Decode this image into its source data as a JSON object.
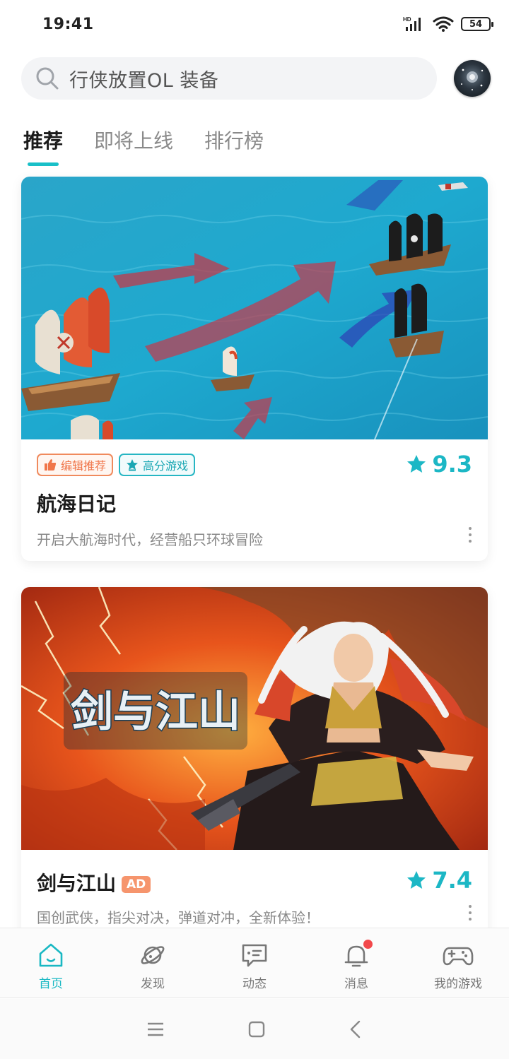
{
  "status_bar": {
    "time": "19:41",
    "battery": "54",
    "network": "HD"
  },
  "search": {
    "placeholder": "行侠放置OL 装备"
  },
  "tabs": [
    {
      "label": "推荐",
      "active": true
    },
    {
      "label": "即将上线",
      "active": false
    },
    {
      "label": "排行榜",
      "active": false
    }
  ],
  "cards": [
    {
      "badges": [
        "编辑推荐",
        "高分游戏"
      ],
      "title": "航海日记",
      "rating": "9.3",
      "description": "开启大航海时代，经营船只环球冒险"
    },
    {
      "title": "剑与江山",
      "ad_label": "AD",
      "rating": "7.4",
      "description": "国创武侠，指尖对决，弹道对冲，全新体验！",
      "banner_logo_text": "剑与江山"
    }
  ],
  "bottom_nav": [
    {
      "label": "首页",
      "icon": "home-icon",
      "active": true
    },
    {
      "label": "发现",
      "icon": "planet-icon",
      "active": false
    },
    {
      "label": "动态",
      "icon": "chat-icon",
      "active": false
    },
    {
      "label": "消息",
      "icon": "bell-icon",
      "active": false,
      "badge": true
    },
    {
      "label": "我的游戏",
      "icon": "gamepad-icon",
      "active": false
    }
  ],
  "colors": {
    "accent": "#19c0c8",
    "badge_orange": "#f0764a",
    "rating": "#1cb7c5",
    "notification": "#f2484b"
  }
}
